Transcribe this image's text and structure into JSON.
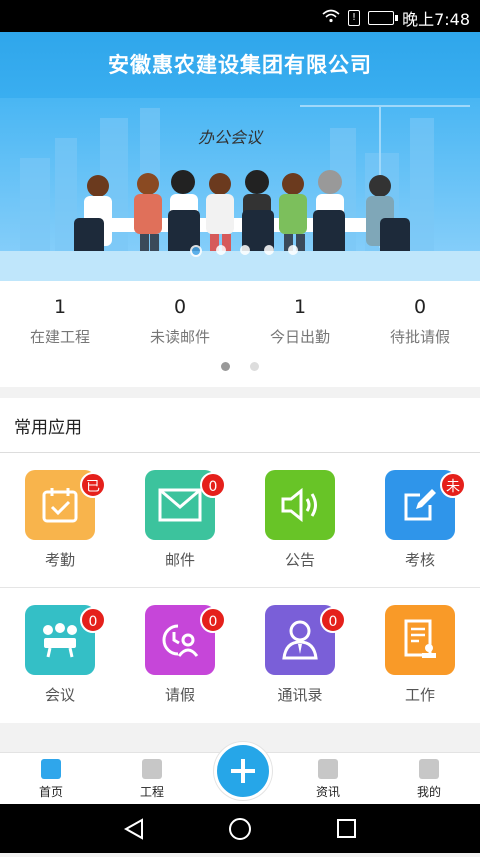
{
  "status_bar": {
    "time": "晚上7:48"
  },
  "header": {
    "title": "安徽惠农建设集团有限公司"
  },
  "banner": {
    "caption": "办公会议"
  },
  "stats": [
    {
      "value": "1",
      "label": "在建工程"
    },
    {
      "value": "0",
      "label": "未读邮件"
    },
    {
      "value": "1",
      "label": "今日出勤"
    },
    {
      "value": "0",
      "label": "待批请假"
    }
  ],
  "apps_section": {
    "title": "常用应用",
    "rows": [
      [
        {
          "label": "考勤",
          "badge": "已",
          "color": "#f8b44c",
          "icon": "calendar-check-icon"
        },
        {
          "label": "邮件",
          "badge": "0",
          "color": "#3cc39d",
          "icon": "mail-icon"
        },
        {
          "label": "公告",
          "badge": "",
          "color": "#68c427",
          "icon": "speaker-icon"
        },
        {
          "label": "考核",
          "badge": "未",
          "color": "#2f95ea",
          "icon": "edit-icon"
        }
      ],
      [
        {
          "label": "会议",
          "badge": "0",
          "color": "#34bfc6",
          "icon": "meeting-icon"
        },
        {
          "label": "请假",
          "badge": "0",
          "color": "#c646d9",
          "icon": "leave-clock-icon"
        },
        {
          "label": "通讯录",
          "badge": "0",
          "color": "#7a5fd8",
          "icon": "contact-icon"
        },
        {
          "label": "工作",
          "badge": "",
          "color": "#f99a28",
          "icon": "document-stamp-icon"
        }
      ]
    ]
  },
  "bottom_nav": [
    {
      "label": "首页",
      "icon": "home-icon"
    },
    {
      "label": "工程",
      "icon": "briefcase-icon"
    },
    {
      "label": "资讯",
      "icon": "mail-icon"
    },
    {
      "label": "我的",
      "icon": "profile-icon"
    }
  ]
}
